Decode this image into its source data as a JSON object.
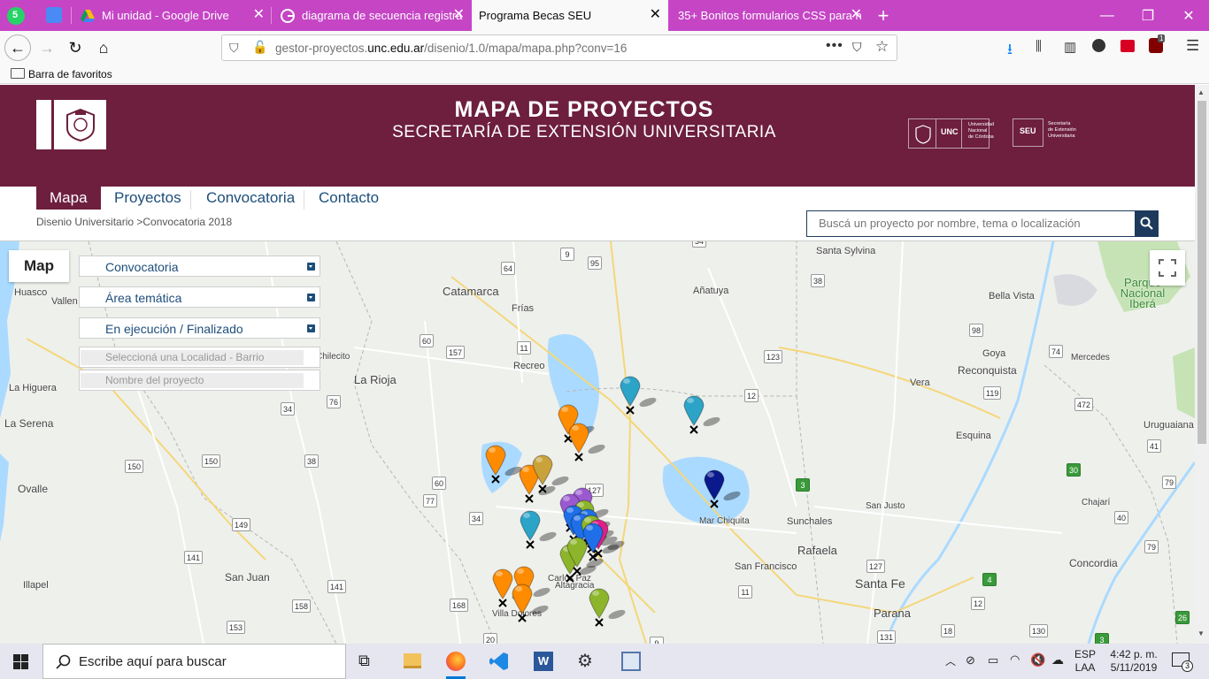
{
  "browser": {
    "tabs": [
      {
        "label": "Mi unidad - Google Drive",
        "active": false
      },
      {
        "label": "diagrama de secuencia registra",
        "active": false
      },
      {
        "label": "Programa Becas SEU",
        "active": true
      },
      {
        "label": "35+ Bonitos formularios CSS para n",
        "active": false
      }
    ],
    "whatsapp_badge": "5",
    "url_prefix": "gestor-proyectos.",
    "url_domain": "unc.edu.ar",
    "url_path": "/disenio/1.0/mapa/mapa.php?conv=16",
    "bookmarks_label": "Barra de favoritos",
    "ublock_count": "1",
    "accent": "#c545c5"
  },
  "page": {
    "title": "MAPA DE PROYECTOS",
    "subtitle": "SECRETARÍA DE EXTENSIÓN UNIVERSITARIA",
    "logo_unc_abbr": "UNC",
    "logo_unc_text": [
      "Universidad",
      "Nacional",
      "de Córdoba"
    ],
    "logo_seu_abbr": "SEU",
    "logo_seu_text": [
      "Secretaría",
      "de Extensión",
      "Universitaria"
    ],
    "brand_color": "#6d1f3d",
    "menu": [
      "Mapa",
      "Proyectos",
      "Convocatoria",
      "Contacto"
    ],
    "breadcrumb": "Disenio Universitario >Convocatoria 2018",
    "search_placeholder": "Buscá un proyecto por nombre, tema o localización"
  },
  "map": {
    "panel_title": "Map",
    "filters": [
      "Convocatoria",
      "Área temática",
      "En ejecución / Finalizado"
    ],
    "locality_placeholder": "Seleccioná una Localidad - Barrio",
    "project_placeholder": "Nombre del proyecto",
    "places": [
      "Santa Sylvina",
      "Parque Nacional Iberá",
      "Huasco",
      "Vallen",
      "Catamarca",
      "Frías",
      "Añatuya",
      "Bella Vista",
      "Recreo",
      "Reconquista",
      "Goya",
      "Mercedes",
      "La Higuera",
      "La Rioja",
      "Vera",
      "La Serena",
      "Esquina",
      "Uruguaiana",
      "Ovalle",
      "Chajarí",
      "San Justo",
      "Sunchales",
      "Illapel",
      "San Juan",
      "Rafaela",
      "San Francisco",
      "Concordia",
      "Santa Fe",
      "Parana",
      "Villa Dolores",
      "Altagracia",
      "Carlos Paz",
      "Mar Chiquita",
      "Chilecito"
    ],
    "route_numbers": [
      "34",
      "64",
      "9",
      "95",
      "38",
      "60",
      "157",
      "11",
      "98",
      "123",
      "74",
      "76",
      "34",
      "12",
      "119",
      "472",
      "41",
      "150",
      "150",
      "38",
      "60",
      "127",
      "30",
      "79",
      "77",
      "34",
      "3",
      "40",
      "149",
      "141",
      "141",
      "158",
      "11",
      "127",
      "4",
      "79",
      "168",
      "12",
      "18",
      "153",
      "20",
      "9",
      "131",
      "130",
      "26",
      "3"
    ],
    "fullscreen_icon": "fullscreen-icon",
    "marker_colors": {
      "orange": "#ff8c00",
      "cyan": "#2ba4c8",
      "navy": "#0a1a8c",
      "olive": "#c9a23a",
      "green": "#8db52c",
      "purple": "#9b59d0",
      "blue": "#1e6fe8",
      "magenta": "#e0208a"
    }
  },
  "taskbar": {
    "search_placeholder": "Escribe aquí para buscar",
    "lang_top": "ESP",
    "lang_bottom": "LAA",
    "time": "4:42 p. m.",
    "date": "5/11/2019",
    "notif_count": "3"
  }
}
